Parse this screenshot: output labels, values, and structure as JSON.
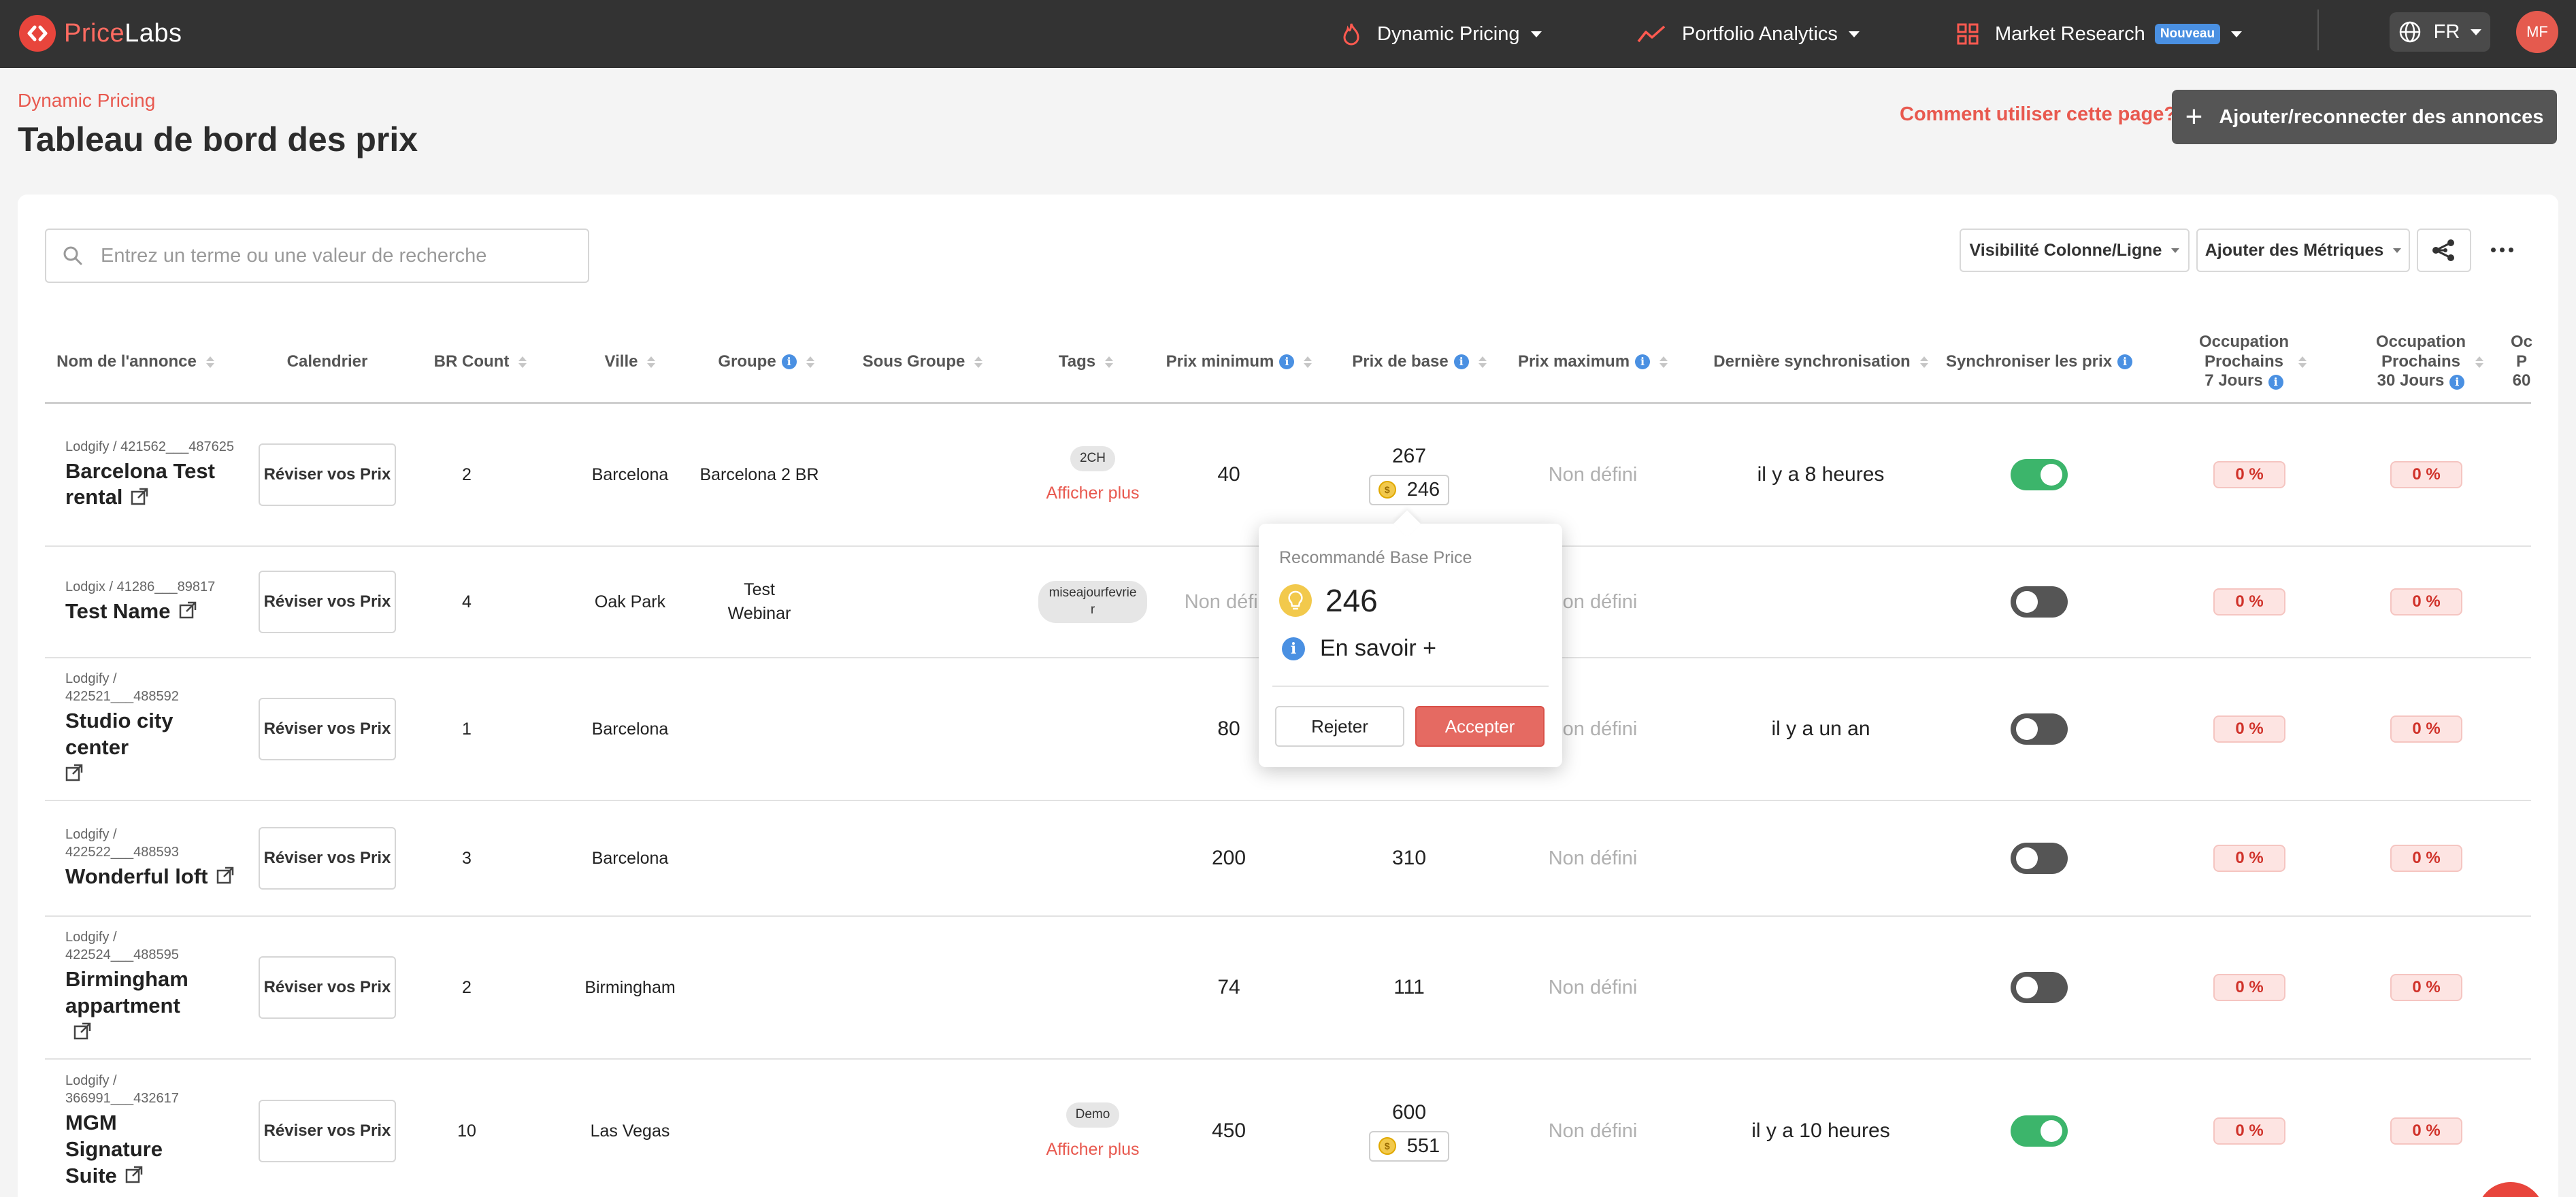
{
  "app": {
    "logo_part1": "Price",
    "logo_part2": "Labs",
    "brand_color": "#e8453c"
  },
  "nav": {
    "dynamic_pricing": "Dynamic Pricing",
    "portfolio_analytics": "Portfolio Analytics",
    "market_research": "Market Research",
    "new_badge": "Nouveau",
    "lang": "FR",
    "avatar": "MF"
  },
  "page": {
    "breadcrumb": "Dynamic Pricing",
    "title": "Tableau de bord des prix",
    "help": "Comment utiliser cette page?",
    "add_button": "Ajouter/reconnecter des annonces"
  },
  "toolbar": {
    "search_placeholder": "Entrez un terme ou une valeur de recherche",
    "visibility": "Visibilité Colonne/Ligne",
    "add_metrics": "Ajouter des Métriques"
  },
  "columns": {
    "name": "Nom de l'annonce",
    "calendar": "Calendrier",
    "br_count": "BR Count",
    "city": "Ville",
    "group": "Groupe",
    "subgroup": "Sous Groupe",
    "tags": "Tags",
    "min_price": "Prix minimum",
    "base_price": "Prix de base",
    "max_price": "Prix maximum",
    "last_sync": "Dernière synchronisation",
    "sync_prices": "Synchroniser les prix",
    "occ7_l1": "Occupation",
    "occ7_l2": "Prochains",
    "occ7_l3": "7 Jours",
    "occ30_l1": "Occupation",
    "occ30_l2": "Prochains",
    "occ30_l3": "30 Jours",
    "occ60_l1": "Oc",
    "occ60_l2": "P",
    "occ60_l3": "60"
  },
  "review_button": "Réviser vos Prix",
  "show_more": "Afficher plus",
  "not_defined": "Non défini",
  "rows": [
    {
      "source": "Lodgify / 421562___487625",
      "name": "Barcelona Test rental",
      "br": "2",
      "city": "Barcelona",
      "group": "Barcelona 2 BR",
      "tag": "2CH",
      "min": "40",
      "base": "267",
      "rec": "246",
      "max": "Non défini",
      "sync": "il y a 8 heures",
      "toggle": "on",
      "occ7": "0 %",
      "occ30": "0 %"
    },
    {
      "source": "Lodgix / 41286___89817",
      "name": "Test Name",
      "br": "4",
      "city": "Oak Park",
      "group": "Test Webinar",
      "tag": "miseajourfevrier",
      "min": "Non défini",
      "base": "",
      "rec": "",
      "max": "Non défini",
      "sync": "",
      "toggle": "off",
      "occ7": "0 %",
      "occ30": "0 %"
    },
    {
      "source": "Lodgify / 422521___488592",
      "name": "Studio city center",
      "br": "1",
      "city": "Barcelona",
      "group": "",
      "tag": "",
      "min": "80",
      "base": "",
      "rec": "",
      "max": "Non défini",
      "sync": "il y a un an",
      "toggle": "off",
      "occ7": "0 %",
      "occ30": "0 %"
    },
    {
      "source": "Lodgify / 422522___488593",
      "name": "Wonderful loft",
      "br": "3",
      "city": "Barcelona",
      "group": "",
      "tag": "",
      "min": "200",
      "base": "310",
      "rec": "",
      "max": "Non défini",
      "sync": "",
      "toggle": "off",
      "occ7": "0 %",
      "occ30": "0 %"
    },
    {
      "source": "Lodgify / 422524___488595",
      "name": "Birmingham appartment",
      "br": "2",
      "city": "Birmingham",
      "group": "",
      "tag": "",
      "min": "74",
      "base": "111",
      "rec": "",
      "max": "Non défini",
      "sync": "",
      "toggle": "off",
      "occ7": "0 %",
      "occ30": "0 %"
    },
    {
      "source": "Lodgify / 366991___432617",
      "name": "MGM Signature Suite",
      "br": "10",
      "city": "Las Vegas",
      "group": "",
      "tag": "Demo",
      "min": "450",
      "base": "600",
      "rec": "551",
      "max": "Non défini",
      "sync": "il y a 10 heures",
      "toggle": "on",
      "occ7": "0 %",
      "occ30": "0 %"
    }
  ],
  "popover": {
    "title": "Recommandé Base Price",
    "value": "246",
    "learn_more": "En savoir +",
    "reject": "Rejeter",
    "accept": "Accepter"
  },
  "colors": {
    "accent_red": "#e8594f",
    "toggle_on": "#3cb56b",
    "toggle_off": "#555555",
    "occ_badge": "#fde4e2"
  }
}
